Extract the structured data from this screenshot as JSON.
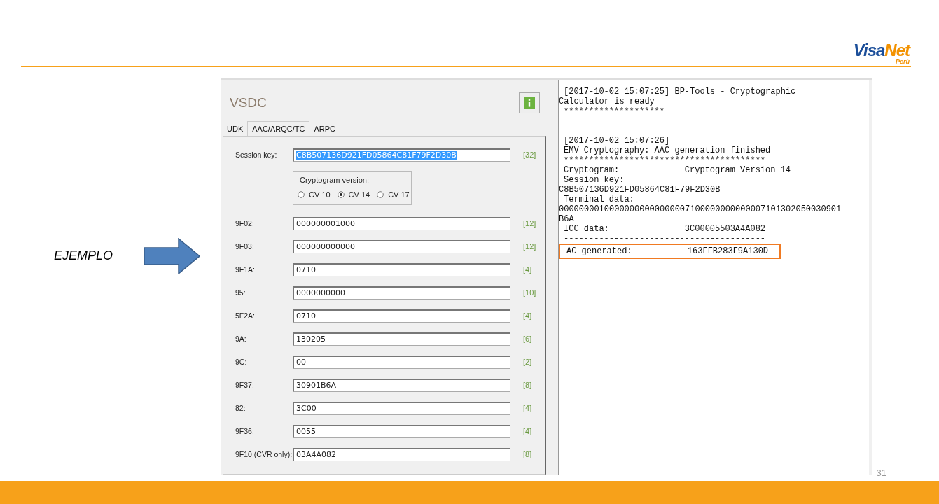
{
  "logo": {
    "brand_first": "Visa",
    "brand_second": "Net",
    "country": "Perú"
  },
  "example_label": "EJEMPLO",
  "app": {
    "title": "VSDC",
    "tabs": [
      {
        "label": "UDK",
        "selected": false
      },
      {
        "label": "AAC/ARQC/TC",
        "selected": true
      },
      {
        "label": "ARPC",
        "selected": false
      }
    ],
    "session_key": {
      "label": "Session key:",
      "value": "C8B507136D921FD05864C81F79F2D30B",
      "length": "[32]",
      "text_selected": true
    },
    "cryptogram_version": {
      "legend": "Cryptogram version:",
      "options": [
        {
          "label": "CV 10",
          "selected": false
        },
        {
          "label": "CV 14",
          "selected": true
        },
        {
          "label": "CV 17",
          "selected": false
        }
      ]
    },
    "fields": [
      {
        "label": "9F02:",
        "value": "000000001000",
        "length": "[12]"
      },
      {
        "label": "9F03:",
        "value": "000000000000",
        "length": "[12]"
      },
      {
        "label": "9F1A:",
        "value": "0710",
        "length": "[4]"
      },
      {
        "label": "95:",
        "value": "0000000000",
        "length": "[10]"
      },
      {
        "label": "5F2A:",
        "value": "0710",
        "length": "[4]"
      },
      {
        "label": "9A:",
        "value": "130205",
        "length": "[6]"
      },
      {
        "label": "9C:",
        "value": "00",
        "length": "[2]"
      },
      {
        "label": "9F37:",
        "value": "30901B6A",
        "length": "[8]"
      },
      {
        "label": "82:",
        "value": "3C00",
        "length": "[4]"
      },
      {
        "label": "9F36:",
        "value": "0055",
        "length": "[4]"
      },
      {
        "label": "9F10 (CVR only):",
        "value": "03A4A082",
        "length": "[8]"
      }
    ]
  },
  "log": {
    "blocks": [
      {
        "lines": [
          {
            "kind": "indented",
            "text": "[2017-10-02 15:07:25] BP-Tools - Cryptographic",
            "highlighted": false
          },
          {
            "kind": "flush",
            "text": "Calculator is ready",
            "highlighted": false
          },
          {
            "kind": "indented",
            "text": "********************",
            "highlighted": false
          }
        ]
      },
      {
        "lines": [
          {
            "kind": "indented",
            "text": "[2017-10-02 15:07:26]",
            "highlighted": false
          },
          {
            "kind": "indented",
            "text": "EMV Cryptography: AAC generation finished",
            "highlighted": false
          },
          {
            "kind": "indented",
            "text": "****************************************",
            "highlighted": false
          },
          {
            "kind": "indented",
            "text": "Cryptogram:             Cryptogram Version 14",
            "highlighted": false
          },
          {
            "kind": "indented",
            "text": "Session key:",
            "highlighted": false
          },
          {
            "kind": "flush",
            "text": "C8B507136D921FD05864C81F79F2D30B",
            "highlighted": false
          },
          {
            "kind": "indented",
            "text": "Terminal data:",
            "highlighted": false
          },
          {
            "kind": "flush",
            "text": "00000000100000000000000007100000000000007101302050030901",
            "highlighted": false
          },
          {
            "kind": "flush",
            "text": "B6A",
            "highlighted": false
          },
          {
            "kind": "indented",
            "text": "ICC data:               3C00005503A4A082",
            "highlighted": false
          },
          {
            "kind": "indented",
            "text": "----------------------------------------",
            "highlighted": false
          },
          {
            "kind": "indented",
            "text": "AC generated:           163FFB283F9A130D",
            "highlighted": true
          }
        ]
      }
    ]
  },
  "page_number": "31"
}
